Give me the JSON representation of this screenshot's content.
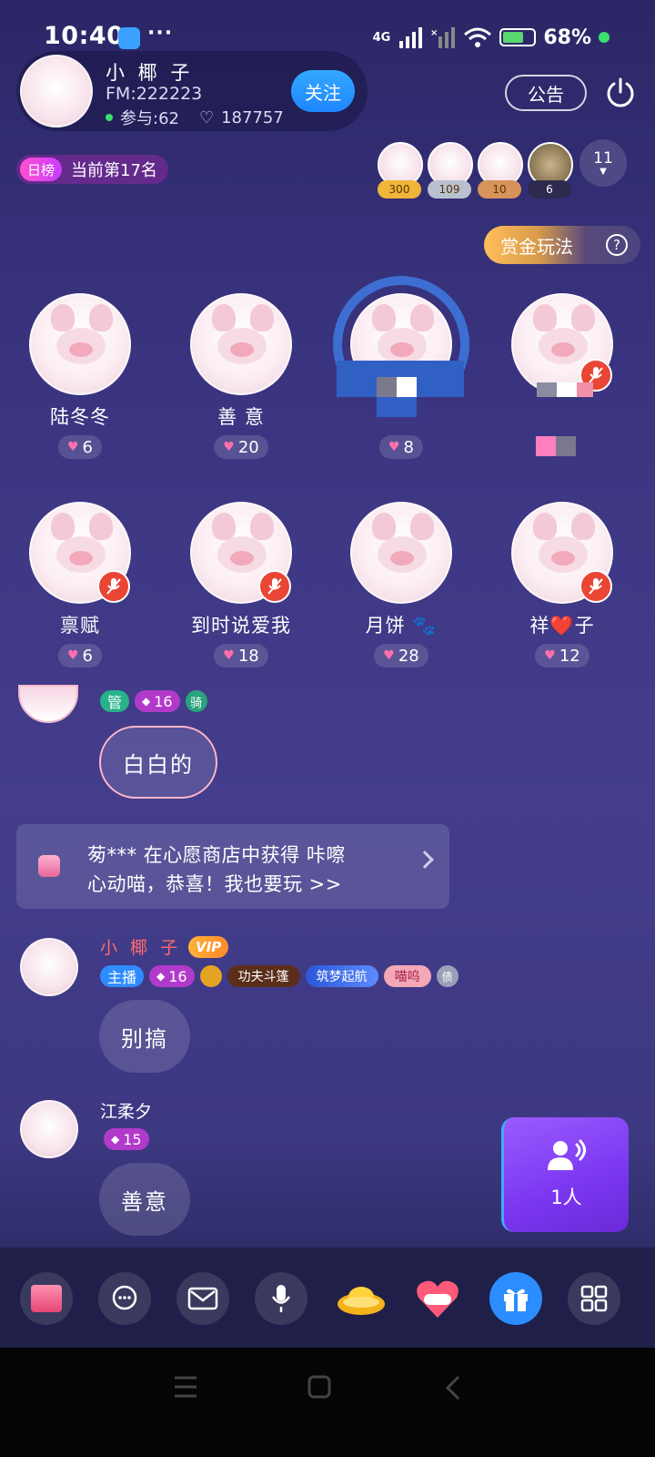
{
  "status_bar": {
    "time": "10:40",
    "dots": "···",
    "network": "4G",
    "battery": "68%"
  },
  "header": {
    "host_name": "小 椰 子",
    "fm": "FM:222223",
    "participants": "参与:62",
    "likes": "187757",
    "follow_label": "关注",
    "notice_label": "公告"
  },
  "ranking": {
    "tag": "日榜",
    "text": "当前第17名"
  },
  "top_contributors": [
    {
      "score": "300",
      "color": "#f0b63a"
    },
    {
      "score": "109",
      "color": "#b9c1d0"
    },
    {
      "score": "10",
      "color": "#d6935a"
    },
    {
      "score": "6",
      "color": "#2e2a4e"
    }
  ],
  "more_count": "11",
  "bounty": {
    "label": "赏金玩法",
    "help": "?"
  },
  "seats": [
    {
      "name": "陆冬冬",
      "likes": "6",
      "muted": false
    },
    {
      "name": "善 意",
      "likes": "20",
      "muted": false
    },
    {
      "name": "",
      "likes": "8",
      "muted": false
    },
    {
      "name": "",
      "likes": "",
      "muted": true
    },
    {
      "name": "禀赋",
      "likes": "6",
      "muted": true
    },
    {
      "name": "到时说爱我",
      "likes": "18",
      "muted": true
    },
    {
      "name": "月饼 🐾",
      "likes": "28",
      "muted": false
    },
    {
      "name": "祥❤️子",
      "likes": "12",
      "muted": true
    }
  ],
  "chat": {
    "msg1": {
      "role": "管",
      "level": "16",
      "extra": "骑",
      "text": "白白的"
    },
    "system": {
      "line1": "茐*** 在心愿商店中获得 咔嚓",
      "line2": "心动喵，恭喜！我也要玩 >>"
    },
    "msg2": {
      "name": "小 椰 子",
      "vip": "VIP",
      "role": "主播",
      "level": "16",
      "badge1": "功夫斗篷",
      "badge2": "筑梦起航",
      "badge3": "喵呜",
      "extra": "债",
      "text": "别搞"
    },
    "msg3": {
      "name": "江柔夕",
      "level": "15",
      "text": "善意"
    }
  },
  "mic_queue": {
    "count": "1人"
  },
  "colors": {
    "accent": "#1f86ff",
    "mute": "#e94635",
    "purple": "#7b36f0"
  }
}
